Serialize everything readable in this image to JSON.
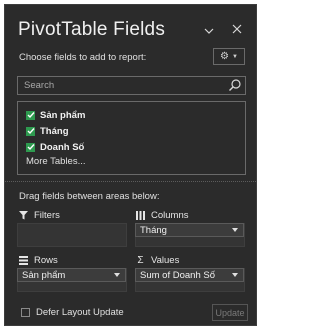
{
  "pane": {
    "title": "PivotTable Fields",
    "subtitle": "Choose fields to add to report:",
    "search_placeholder": "Search",
    "fields": [
      {
        "label": "Sản phẩm",
        "checked": true
      },
      {
        "label": "Tháng",
        "checked": true
      },
      {
        "label": "Doanh Số",
        "checked": true
      }
    ],
    "more_tables": "More Tables...",
    "drag_hint": "Drag fields between areas below:"
  },
  "areas": {
    "filters": {
      "label": "Filters",
      "items": []
    },
    "columns": {
      "label": "Columns",
      "items": [
        "Tháng"
      ]
    },
    "rows": {
      "label": "Rows",
      "items": [
        "Sản phẩm"
      ]
    },
    "values": {
      "label": "Values",
      "items": [
        "Sum of Doanh Số"
      ]
    }
  },
  "footer": {
    "defer_label": "Defer Layout Update",
    "defer_checked": false,
    "update_label": "Update"
  },
  "icons": [
    "chevron-down-icon",
    "close-icon",
    "gear-icon",
    "search-icon",
    "check-icon",
    "filter-icon",
    "columns-icon",
    "rows-icon",
    "sigma-icon"
  ],
  "colors": {
    "background": "#2b2b2b",
    "checkbox": "#2e9a4f",
    "text": "#e6e6e6",
    "border": "#6a6a6a"
  }
}
